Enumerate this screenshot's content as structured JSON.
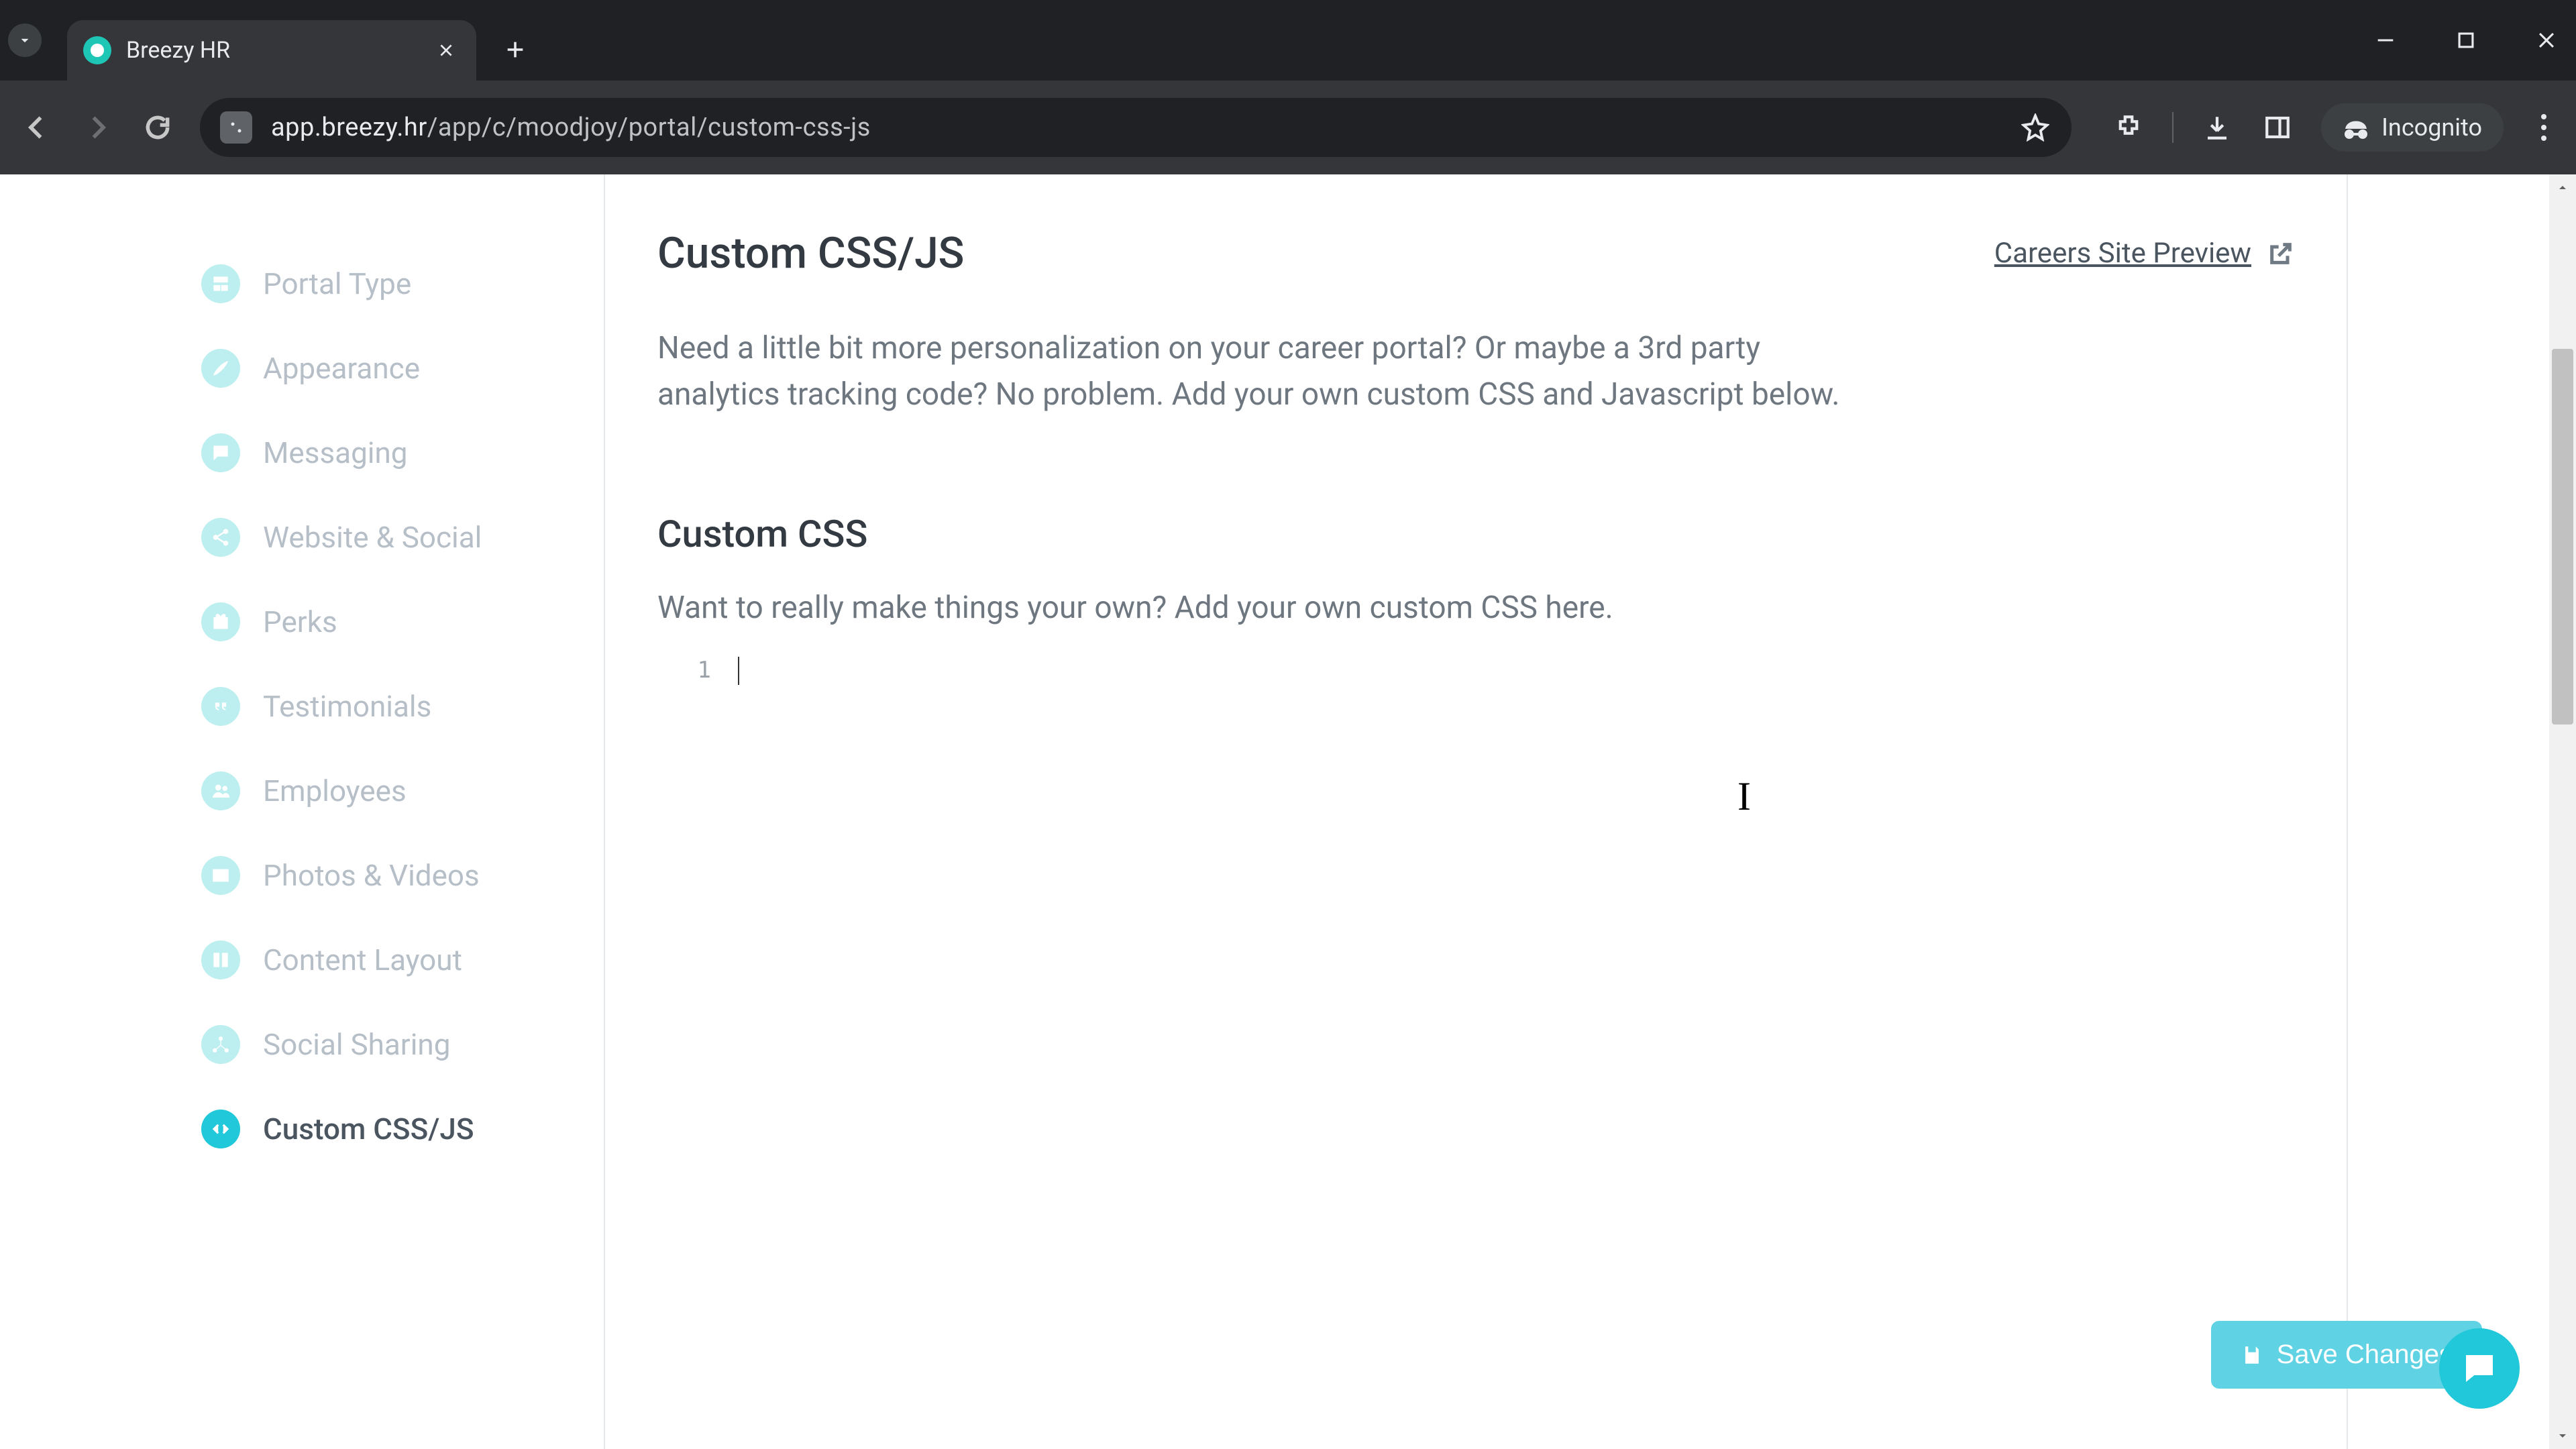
{
  "browser": {
    "tab_title": "Breezy HR",
    "url_host": "app.breezy.hr",
    "url_path": "/app/c/moodjoy/portal/custom-css-js",
    "incognito_label": "Incognito"
  },
  "sidebar": {
    "items": [
      {
        "label": "Portal Type",
        "icon": "layout-icon",
        "active": false
      },
      {
        "label": "Appearance",
        "icon": "brush-icon",
        "active": false
      },
      {
        "label": "Messaging",
        "icon": "chat-icon",
        "active": false
      },
      {
        "label": "Website & Social",
        "icon": "share-icon",
        "active": false
      },
      {
        "label": "Perks",
        "icon": "gift-icon",
        "active": false
      },
      {
        "label": "Testimonials",
        "icon": "quote-icon",
        "active": false
      },
      {
        "label": "Employees",
        "icon": "users-icon",
        "active": false
      },
      {
        "label": "Photos & Videos",
        "icon": "media-icon",
        "active": false
      },
      {
        "label": "Content Layout",
        "icon": "columns-icon",
        "active": false
      },
      {
        "label": "Social Sharing",
        "icon": "network-icon",
        "active": false
      },
      {
        "label": "Custom CSS/JS",
        "icon": "code-icon",
        "active": true
      }
    ]
  },
  "main": {
    "title": "Custom CSS/JS",
    "preview_link": "Careers Site Preview",
    "intro": "Need a little bit more personalization on your career portal? Or maybe a 3rd party analytics tracking code? No problem. Add your own custom CSS and Javascript below.",
    "css_section_title": "Custom CSS",
    "css_section_sub": "Want to really make things your own? Add your own custom CSS here.",
    "editor_line_no": "1",
    "save_label": "Save Changes"
  },
  "colors": {
    "accent": "#21c8d9",
    "accent_light": "#bdeff0",
    "save_btn": "#5fd2e3"
  }
}
